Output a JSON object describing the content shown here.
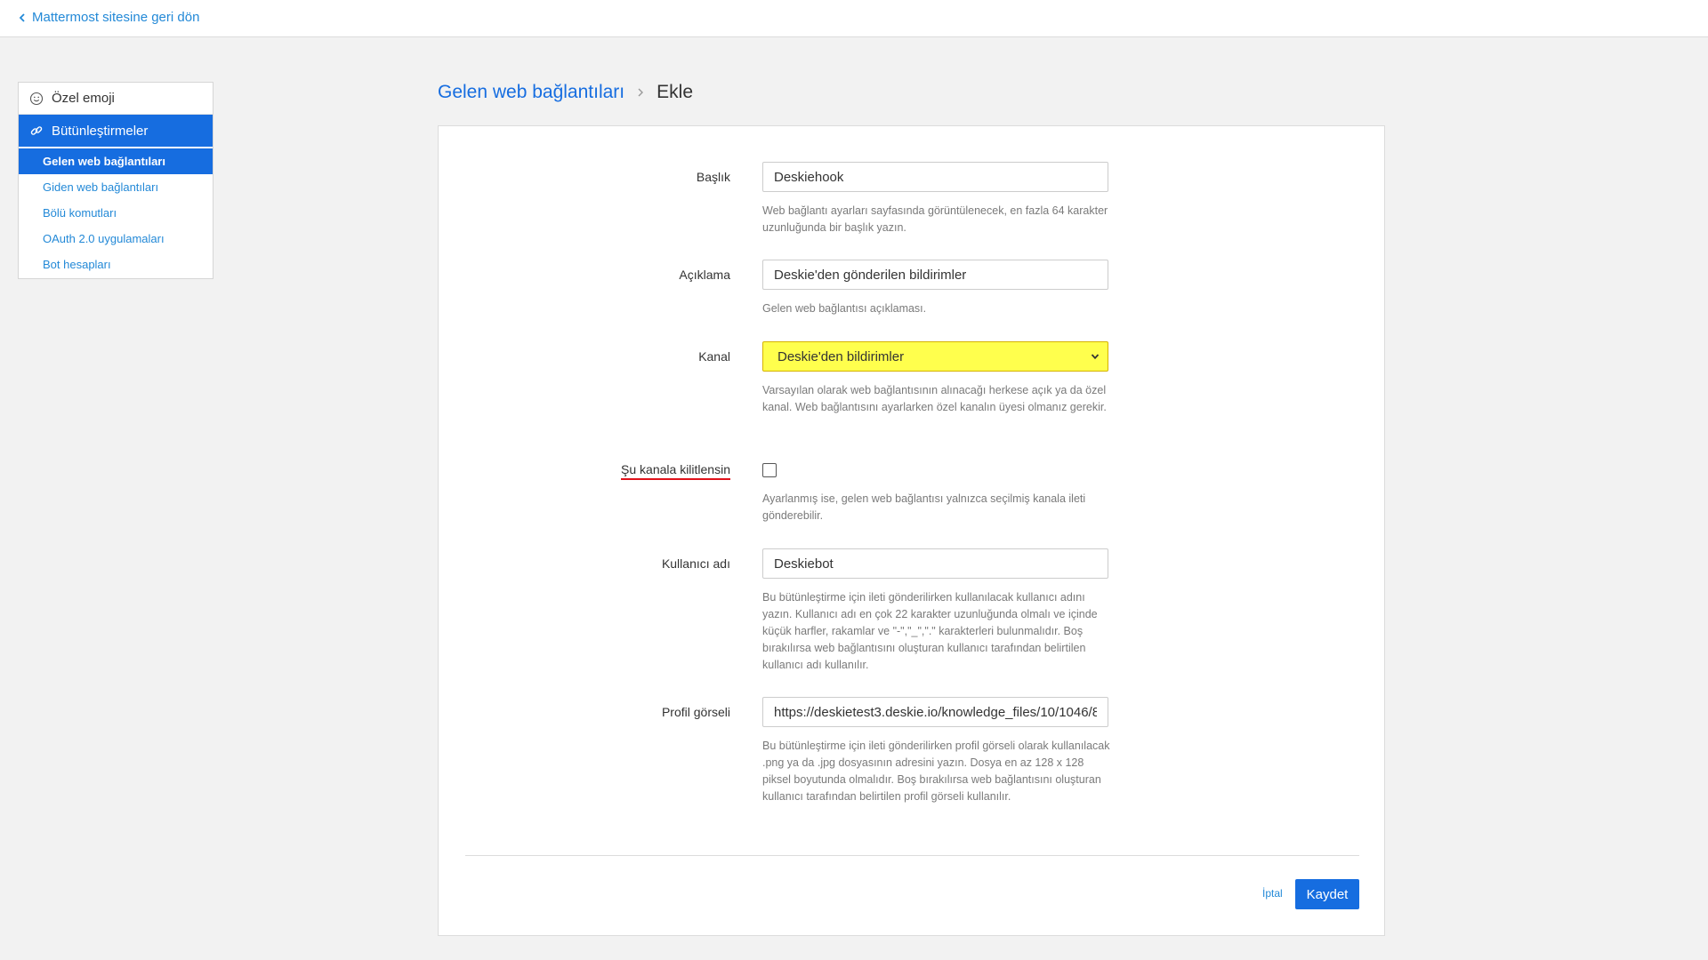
{
  "topbar": {
    "back_label": "Mattermost sitesine geri dön",
    "back_icon": "chevron-left-icon"
  },
  "sidebar": {
    "sections": [
      {
        "label": "Özel emoji",
        "icon": "smiley-icon"
      },
      {
        "label": "Bütünleştirmeler",
        "icon": "link-icon"
      }
    ],
    "items": [
      {
        "label": "Gelen web bağlantıları"
      },
      {
        "label": "Giden web bağlantıları"
      },
      {
        "label": "Bölü komutları"
      },
      {
        "label": "OAuth 2.0 uygulamaları"
      },
      {
        "label": "Bot hesapları"
      }
    ]
  },
  "breadcrumb": {
    "parent": "Gelen web bağlantıları",
    "current": "Ekle"
  },
  "form": {
    "title": {
      "label": "Başlık",
      "value": "Deskiehook",
      "help": "Web bağlantı ayarları sayfasında görüntülenecek, en fazla 64 karakter uzunluğunda bir başlık yazın."
    },
    "description": {
      "label": "Açıklama",
      "value": "Deskie'den gönderilen bildirimler",
      "help": "Gelen web bağlantısı açıklaması."
    },
    "channel": {
      "label": "Kanal",
      "value": "Deskie'den bildirimler",
      "help": "Varsayılan olarak web bağlantısının alınacağı herkese açık ya da özel kanal. Web bağlantısını ayarlarken özel kanalın üyesi olmanız gerekir."
    },
    "lock": {
      "label": "Şu kanala kilitlensin",
      "checked": false,
      "help": "Ayarlanmış ise, gelen web bağlantısı yalnızca seçilmiş kanala ileti gönderebilir."
    },
    "username": {
      "label": "Kullanıcı adı",
      "value": "Deskiebot",
      "help": "Bu bütünleştirme için ileti gönderilirken kullanılacak kullanıcı adını yazın. Kullanıcı adı en çok 22 karakter uzunluğunda olmalı ve içinde küçük harfler, rakamlar ve \"-\",\"_\",\".\" karakterleri bulunmalıdır. Boş bırakılırsa web bağlantısını oluşturan kullanıcı tarafından belirtilen kullanıcı adı kullanılır."
    },
    "profile_image": {
      "label": "Profil görseli",
      "value": "https://deskietest3.deskie.io/knowledge_files/10/1046/8",
      "help": "Bu bütünleştirme için ileti gönderilirken profil görseli olarak kullanılacak .png ya da .jpg dosyasının adresini yazın. Dosya en az 128 x 128 piksel boyutunda olmalıdır. Boş bırakılırsa web bağlantısını oluşturan kullanıcı tarafından belirtilen profil görseli kullanılır."
    }
  },
  "actions": {
    "cancel_label": "İptal",
    "save_label": "Kaydet"
  },
  "colors": {
    "accent": "#166de0",
    "link": "#2389d7",
    "highlight": "#ffff4d",
    "underline": "#e0121b"
  }
}
